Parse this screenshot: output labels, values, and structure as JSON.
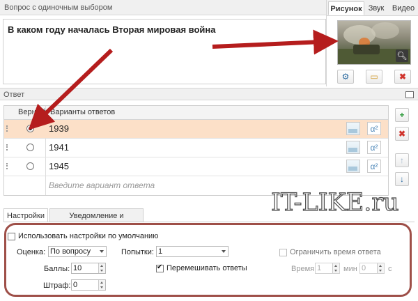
{
  "question": {
    "header": "Вопрос с одиночным выбором",
    "text": "В каком году началась Вторая мировая война"
  },
  "media": {
    "tabs": [
      "Рисунок",
      "Звук",
      "Видео"
    ],
    "buttons": {
      "settings_icon": "gear-icon",
      "open_icon": "folder-icon",
      "delete_icon": "close-icon"
    }
  },
  "answers": {
    "header": "Ответ",
    "columns": {
      "correct": "Верный",
      "variants": "Варианты ответов"
    },
    "rows": [
      {
        "value": "1939",
        "selected": true
      },
      {
        "value": "1941",
        "selected": false
      },
      {
        "value": "1945",
        "selected": false
      }
    ],
    "placeholder": "Введите вариант ответа",
    "alpha_label": "α²"
  },
  "bottom_tabs": [
    "Настройки",
    "Уведомление и ветвление"
  ],
  "settings": {
    "use_defaults": "Использовать настройки по умолчанию",
    "grading_label": "Оценка:",
    "grading_value": "По вопросу",
    "attempts_label": "Попытки:",
    "attempts_value": "1",
    "limit_time": "Ограничить время ответа",
    "points_label": "Баллы:",
    "points_value": "10",
    "shuffle": "Перемешивать ответы",
    "time_label": "Время:",
    "time_value": "1",
    "min_label": "мин",
    "sec_value": "0",
    "sec_label": "с",
    "penalty_label": "Штраф:",
    "penalty_value": "0"
  },
  "watermark": "IT-LIKE.ru",
  "colors": {
    "selected_row": "#fce0c8",
    "arrow": "#b51d1d",
    "ring": "#9e4f48"
  }
}
